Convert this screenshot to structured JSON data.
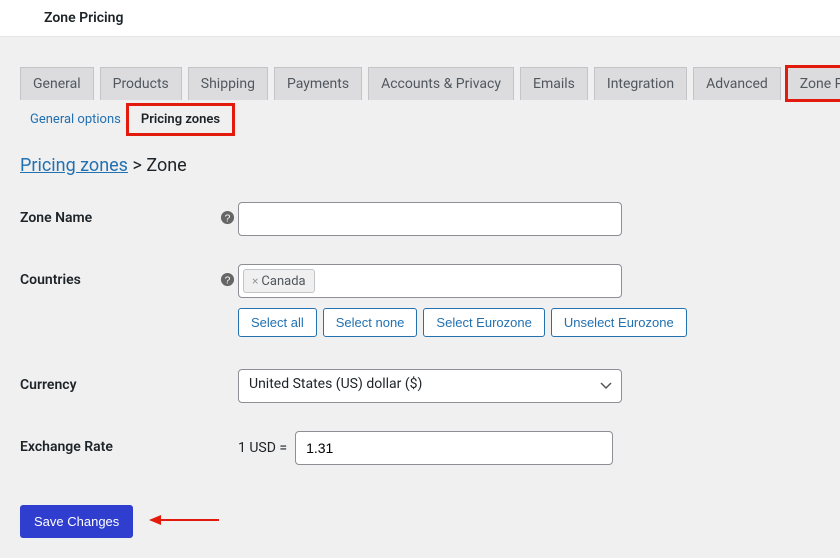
{
  "header": {
    "title": "Zone Pricing"
  },
  "tabs": [
    {
      "label": "General"
    },
    {
      "label": "Products"
    },
    {
      "label": "Shipping"
    },
    {
      "label": "Payments"
    },
    {
      "label": "Accounts & Privacy"
    },
    {
      "label": "Emails"
    },
    {
      "label": "Integration"
    },
    {
      "label": "Advanced"
    },
    {
      "label": "Zone Pricing"
    }
  ],
  "subnav": {
    "general_options": "General options",
    "pricing_zones": "Pricing zones"
  },
  "breadcrumb": {
    "parent": "Pricing zones",
    "separator": ">",
    "current": "Zone"
  },
  "form": {
    "zone_name": {
      "label": "Zone Name",
      "value": ""
    },
    "countries": {
      "label": "Countries",
      "tags": [
        {
          "name": "Canada"
        }
      ],
      "buttons": {
        "select_all": "Select all",
        "select_none": "Select none",
        "select_eurozone": "Select Eurozone",
        "unselect_eurozone": "Unselect Eurozone"
      }
    },
    "currency": {
      "label": "Currency",
      "value": "United States (US) dollar ($)"
    },
    "exchange_rate": {
      "label": "Exchange Rate",
      "prefix": "1 USD =",
      "value": "1.31"
    },
    "save_button": "Save Changes"
  }
}
